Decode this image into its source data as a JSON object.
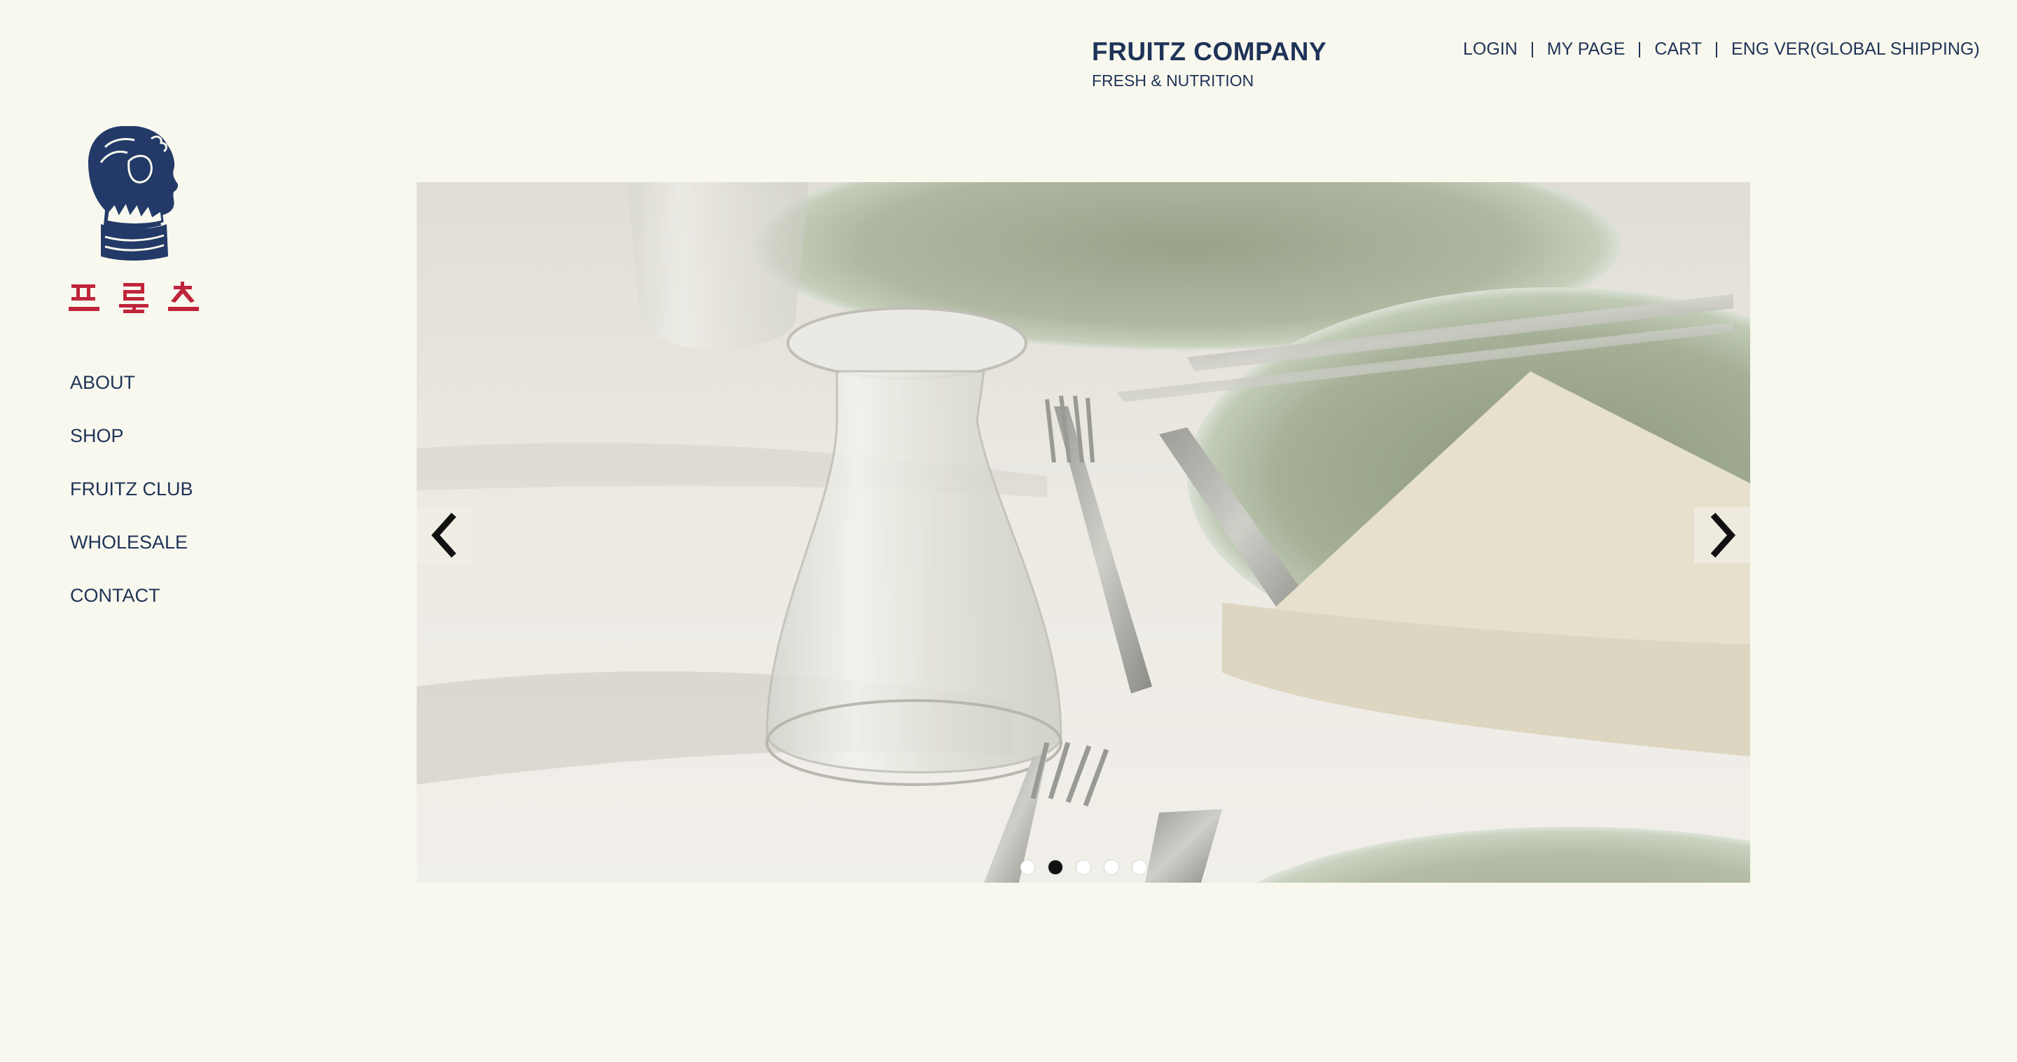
{
  "brand": {
    "title": "FRUITZ COMPANY",
    "subtitle": "FRESH & NUTRITION"
  },
  "topnav": {
    "login": "LOGIN",
    "mypage": "MY PAGE",
    "cart": "CART",
    "eng": "ENG VER(GLOBAL SHIPPING)"
  },
  "logo": {
    "korean_text": "프룻츠",
    "icon": "bust-profile-icon"
  },
  "sidenav": {
    "items": [
      {
        "label": "ABOUT"
      },
      {
        "label": "SHOP"
      },
      {
        "label": "FRUITZ CLUB"
      },
      {
        "label": "WHOLESALE"
      },
      {
        "label": "CONTACT"
      }
    ]
  },
  "slider": {
    "prev_icon": "chevron-left-icon",
    "next_icon": "chevron-right-icon",
    "slide_count": 5,
    "active_index": 1
  },
  "colors": {
    "background": "#f8f8ee",
    "navy": "#1f3358",
    "logo_red": "#c0243a"
  }
}
